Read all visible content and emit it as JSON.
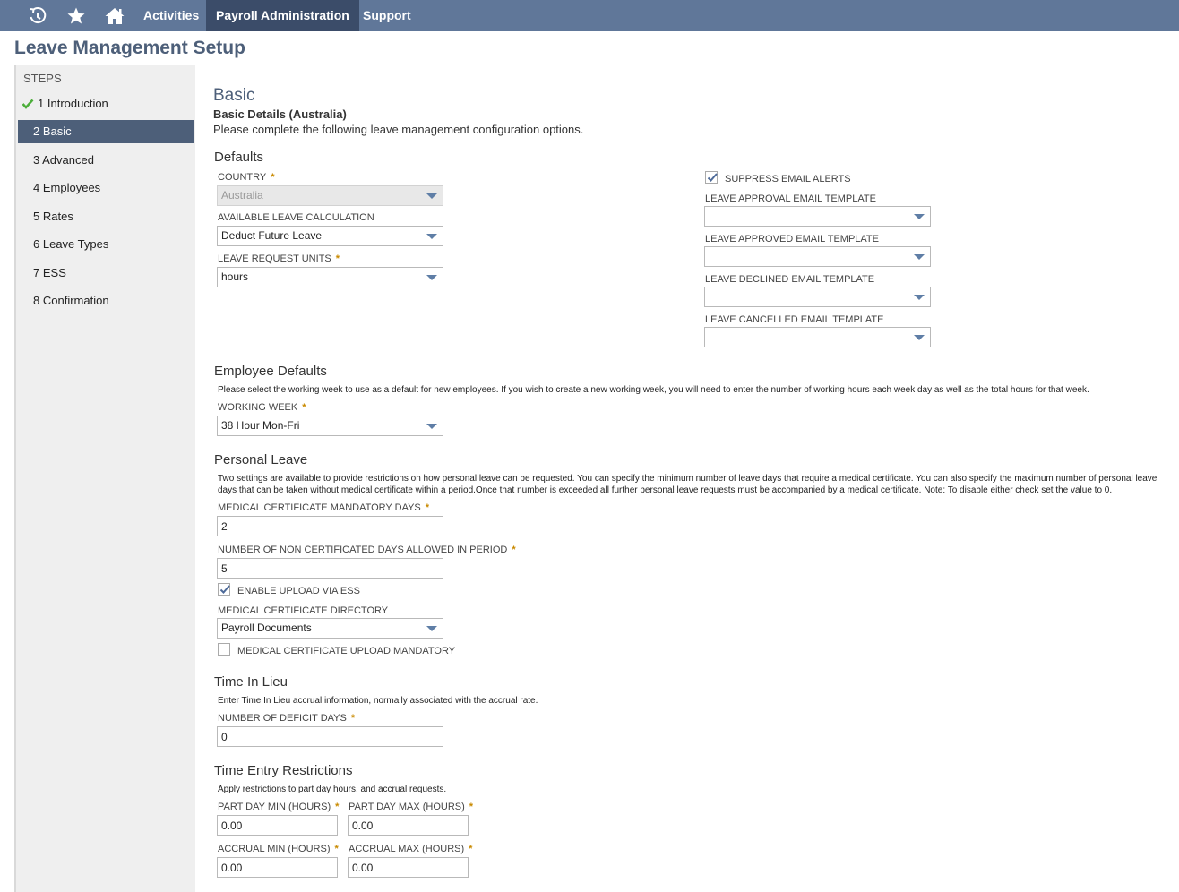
{
  "nav": {
    "items": [
      "Activities",
      "Payroll Administration",
      "Support"
    ],
    "icons": [
      "recent-icon",
      "star-icon",
      "home-icon"
    ],
    "colors": {
      "bar": "#607799",
      "active": "#3b4c69"
    }
  },
  "page": {
    "title": "Leave Management Setup"
  },
  "steps": {
    "header": "STEPS",
    "items": [
      {
        "num": "1",
        "label": "Introduction",
        "done": true
      },
      {
        "num": "2",
        "label": "Basic",
        "active": true
      },
      {
        "num": "3",
        "label": "Advanced"
      },
      {
        "num": "4",
        "label": "Employees"
      },
      {
        "num": "5",
        "label": "Rates"
      },
      {
        "num": "6",
        "label": "Leave Types"
      },
      {
        "num": "7",
        "label": "ESS"
      },
      {
        "num": "8",
        "label": "Confirmation"
      }
    ]
  },
  "main": {
    "heading": "Basic",
    "subheading": "Basic Details (Australia)",
    "intro": "Please complete the following leave management configuration options.",
    "defaults": {
      "title": "Defaults",
      "country": {
        "label": "COUNTRY",
        "value": "Australia",
        "disabled": true,
        "required": "*"
      },
      "available_leave": {
        "label": "AVAILABLE LEAVE CALCULATION",
        "value": "Deduct Future Leave"
      },
      "request_units": {
        "label": "LEAVE REQUEST UNITS",
        "value": "hours",
        "required": "*"
      },
      "suppress_email": {
        "label": "SUPPRESS EMAIL ALERTS",
        "checked": true
      },
      "approval_template": {
        "label": "LEAVE APPROVAL EMAIL TEMPLATE",
        "value": ""
      },
      "approved_template": {
        "label": "LEAVE APPROVED EMAIL TEMPLATE",
        "value": ""
      },
      "declined_template": {
        "label": "LEAVE DECLINED EMAIL TEMPLATE",
        "value": ""
      },
      "cancelled_template": {
        "label": "LEAVE CANCELLED EMAIL TEMPLATE",
        "value": ""
      }
    },
    "employee_defaults": {
      "title": "Employee Defaults",
      "desc": "Please select the working week to use as a default for new employees. If you wish to create a new working week, you will need to enter the number of working hours each week day as well as the total hours for that week.",
      "working_week": {
        "label": "WORKING WEEK",
        "value": "38 Hour Mon-Fri",
        "required": "*"
      }
    },
    "personal_leave": {
      "title": "Personal Leave",
      "desc": "Two settings are available to provide restrictions on how personal leave can be requested. You can specify the minimum number of leave days that require a medical certificate. You can also specify the maximum number of personal leave days that can be taken without medical certificate within a period.Once that number is exceeded all further personal leave requests must be accompanied by a medical certificate. Note: To disable either check set the value to 0.",
      "mandatory_days": {
        "label": "MEDICAL CERTIFICATE MANDATORY DAYS",
        "value": "2",
        "required": "*"
      },
      "non_cert_days": {
        "label": "NUMBER OF NON CERTIFICATED DAYS ALLOWED IN PERIOD",
        "value": "5",
        "required": "*"
      },
      "enable_upload": {
        "label": "ENABLE UPLOAD VIA ESS",
        "checked": true
      },
      "cert_directory": {
        "label": "MEDICAL CERTIFICATE DIRECTORY",
        "value": "Payroll Documents"
      },
      "upload_mandatory": {
        "label": "MEDICAL CERTIFICATE UPLOAD MANDATORY",
        "checked": false
      }
    },
    "time_in_lieu": {
      "title": "Time In Lieu",
      "desc": "Enter Time In Lieu accrual information, normally associated with the accrual rate.",
      "deficit_days": {
        "label": "NUMBER OF DEFICIT DAYS",
        "value": "0",
        "required": "*"
      }
    },
    "time_entry": {
      "title": "Time Entry Restrictions",
      "desc": "Apply restrictions to part day hours, and accrual requests.",
      "part_min": {
        "label": "PART DAY MIN (HOURS)",
        "value": "0.00",
        "required": "*"
      },
      "part_max": {
        "label": "PART DAY MAX (HOURS)",
        "value": "0.00",
        "required": "*"
      },
      "accrual_min": {
        "label": "ACCRUAL MIN (HOURS)",
        "value": "0.00",
        "required": "*"
      },
      "accrual_max": {
        "label": "ACCRUAL MAX (HOURS)",
        "value": "0.00",
        "required": "*"
      }
    }
  }
}
